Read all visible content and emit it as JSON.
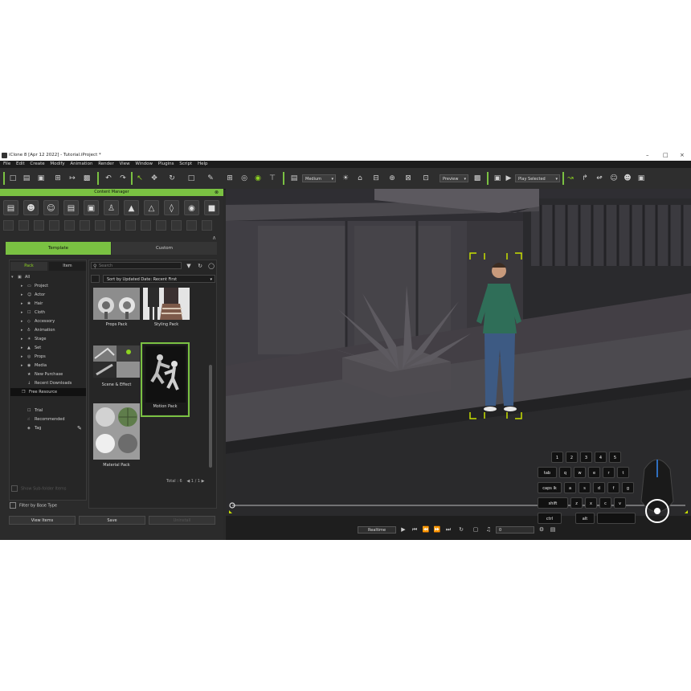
{
  "window": {
    "title": "iClone 8 [Apr 12 2022] - Tutorial.iProject *",
    "minimize": "–",
    "maximize": "□",
    "close": "×"
  },
  "menu": [
    "File",
    "Edit",
    "Create",
    "Modify",
    "Animation",
    "Render",
    "View",
    "Window",
    "Plugins",
    "Script",
    "Help"
  ],
  "toolbar": {
    "quality": "Medium",
    "preview": "Preview",
    "play_mode": "Play Selected"
  },
  "content_manager": {
    "title": "Content Manager",
    "tabs": {
      "template": "Template",
      "custom": "Custom"
    },
    "subtabs": {
      "pack": "Pack",
      "item": "Item"
    },
    "search_placeholder": "Search",
    "sort": "Sort by Updated Date: Recent First",
    "tree": [
      {
        "label": "All",
        "icon": "▣"
      },
      {
        "label": "Project",
        "icon": "▭"
      },
      {
        "label": "Actor",
        "icon": "☺"
      },
      {
        "label": "Hair",
        "icon": "❀"
      },
      {
        "label": "Cloth",
        "icon": "☐"
      },
      {
        "label": "Accessory",
        "icon": "◇"
      },
      {
        "label": "Animation",
        "icon": "♁"
      },
      {
        "label": "Stage",
        "icon": "☀"
      },
      {
        "label": "Set",
        "icon": "▲"
      },
      {
        "label": "Props",
        "icon": "◎"
      },
      {
        "label": "Media",
        "icon": "◉"
      },
      {
        "label": "New Purchase",
        "icon": "★"
      },
      {
        "label": "Recent Downloads",
        "icon": "↓"
      },
      {
        "label": "Free Resource",
        "icon": "❐"
      },
      {
        "label": "Trial",
        "icon": "☐"
      },
      {
        "label": "Recommended",
        "icon": "☝"
      },
      {
        "label": "Tag",
        "icon": "◈"
      }
    ],
    "packs": [
      {
        "name": "Props Pack"
      },
      {
        "name": "Styling Pack"
      },
      {
        "name": "Scene & Effect"
      },
      {
        "name": "Motion Pack"
      },
      {
        "name": "Material Pack"
      }
    ],
    "total_label": "Total : 6",
    "page_current": "1",
    "page_total": "1",
    "filter_label": "Filter by Base Type",
    "faded_option": "Show Sub-folder Items",
    "buttons": {
      "view_items": "View Items",
      "save": "Save",
      "uninstall": "Uninstall"
    }
  },
  "timeline": {
    "mode": "Realtime",
    "frame": "0"
  },
  "keyboard": {
    "row1": [
      "1",
      "2",
      "3",
      "4",
      "5"
    ],
    "row2": [
      "tab",
      "q",
      "w",
      "e",
      "r",
      "t"
    ],
    "row3": [
      "caps lk",
      "a",
      "s",
      "d",
      "f",
      "g"
    ],
    "row4": [
      "shift",
      "z",
      "x",
      "c",
      "v"
    ],
    "row5": [
      "ctrl",
      "alt"
    ]
  },
  "colors": {
    "accent": "#7ac142",
    "panel_bg": "#2b2b2b",
    "viewport_bg": "#333333",
    "selection_corner": "#c8e000"
  }
}
